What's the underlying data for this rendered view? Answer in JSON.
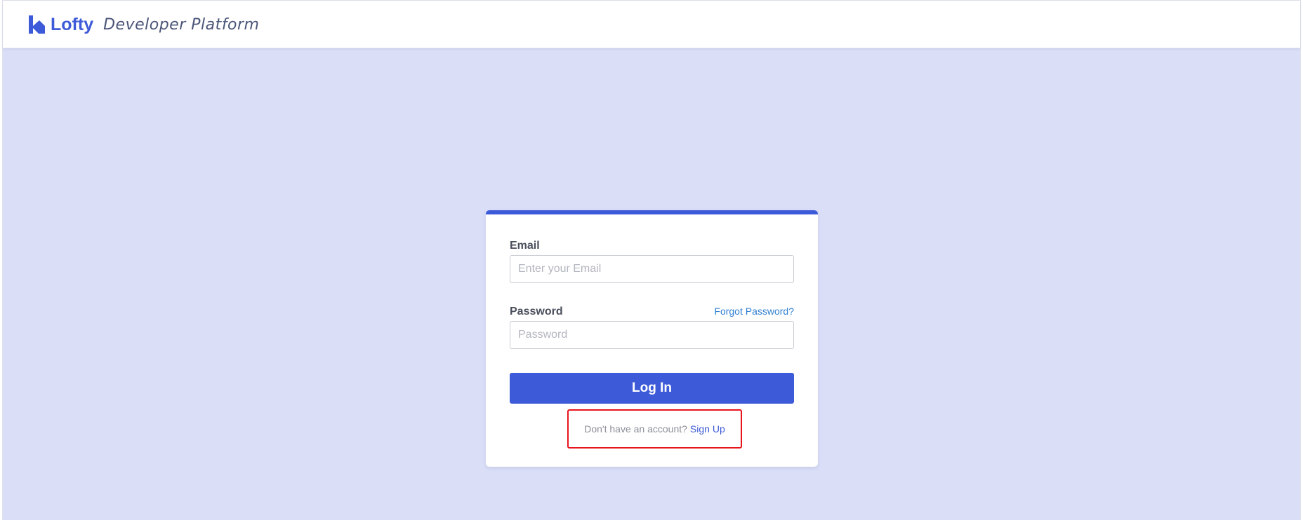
{
  "header": {
    "logo_text": "Lofty",
    "platform_title": "Developer Platform"
  },
  "login_form": {
    "email_label": "Email",
    "email_placeholder": "Enter your Email",
    "email_value": "",
    "password_label": "Password",
    "forgot_password_text": "Forgot Password?",
    "password_placeholder": "Password",
    "password_value": "",
    "login_button_label": "Log In",
    "signup_question": "Don't have an account?",
    "signup_link_text": "Sign Up"
  },
  "icons": {
    "logo": "lofty-logo-icon"
  },
  "colors": {
    "brand": "#3d5ad8",
    "background": "#dadef7",
    "link": "#2f7fd1",
    "highlight": "#e8141c"
  }
}
